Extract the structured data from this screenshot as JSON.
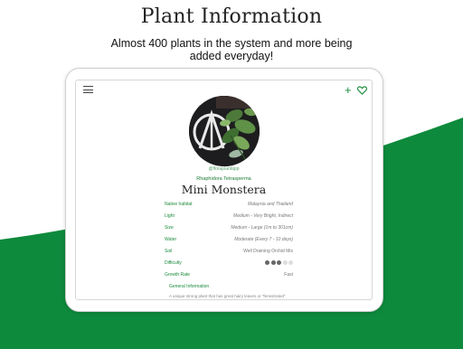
{
  "hero": {
    "title": "Plant Information",
    "subtitle": "Almost 400 plants in the system and more being added everyday!"
  },
  "colors": {
    "brand_green": "#0e8a3c",
    "accent_green": "#1a8a3c"
  },
  "app": {
    "icons": {
      "menu": "menu-icon",
      "add": "plus-icon",
      "favorite": "heart-icon"
    },
    "plant": {
      "handle": "@floraplantapp",
      "scientific_name": "Rhaphidora Tetrasperma",
      "common_name": "Mini Monstera",
      "attributes": [
        {
          "label": "Native habitat",
          "value": "Malaysia and Thailand"
        },
        {
          "label": "Light",
          "value": "Medium - Very Bright, Indirect"
        },
        {
          "label": "Size",
          "value": "Medium - Large (1m to 301cm)"
        },
        {
          "label": "Water",
          "value": "Moderate (Every 7 - 10 days)"
        },
        {
          "label": "Soil",
          "value": "Well Draining Orchid Mix"
        },
        {
          "label": "Difficulty",
          "rating": 3,
          "rating_max": 5
        },
        {
          "label": "Growth Rate",
          "value": "Fast"
        }
      ],
      "general_title": "General Information",
      "general_text": "A unique strong plant that has great hairy leaves or \"fenestrated\""
    }
  }
}
